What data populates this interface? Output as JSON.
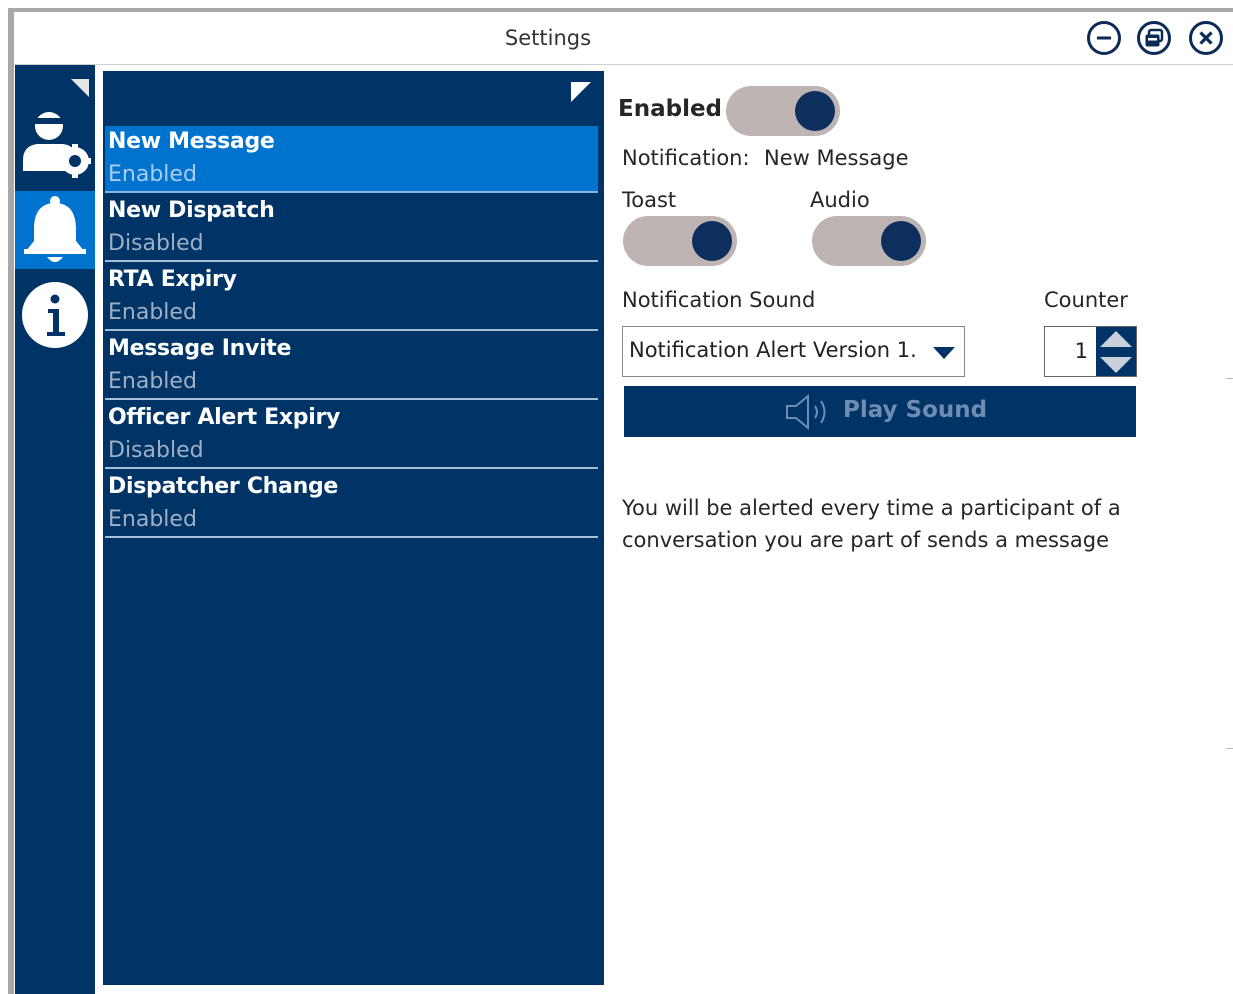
{
  "window": {
    "title": "Settings"
  },
  "titlebar": {
    "buttons": [
      "minimize-icon",
      "restore-icon",
      "close-icon"
    ]
  },
  "rail": {
    "items": [
      "user-settings-icon",
      "bell-icon",
      "info-icon"
    ],
    "active": "bell-icon"
  },
  "notifications": [
    {
      "title": "New Message",
      "status": "Enabled"
    },
    {
      "title": "New Dispatch",
      "status": "Disabled"
    },
    {
      "title": "RTA Expiry",
      "status": "Enabled"
    },
    {
      "title": "Message Invite",
      "status": "Enabled"
    },
    {
      "title": "Officer Alert Expiry",
      "status": "Disabled"
    },
    {
      "title": "Dispatcher Change",
      "status": "Enabled"
    }
  ],
  "detail": {
    "enabled_label": "Enabled",
    "notification_label": "Notification:",
    "notification_name": "New Message",
    "toast_label": "Toast",
    "audio_label": "Audio",
    "sound_label": "Notification Sound",
    "sound_value": "Notification Alert Version 1.",
    "counter_label": "Counter",
    "counter_value": "1",
    "play_label": "Play Sound",
    "description": "You will be alerted every time a participant of a conversation you are part of sends a message"
  },
  "colors": {
    "navy": "#003366",
    "selected": "#0073cf",
    "toggle_track": "#bfb4b4",
    "toggle_knob": "#0c2f5e"
  }
}
